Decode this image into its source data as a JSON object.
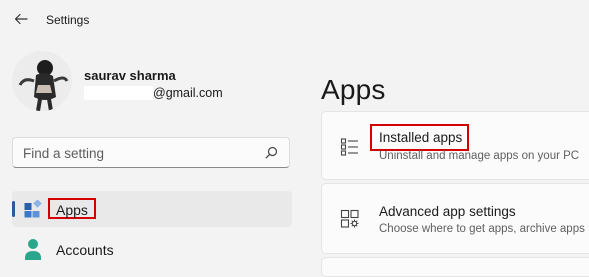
{
  "window": {
    "title": "Settings"
  },
  "profile": {
    "name": "saurav sharma",
    "email_domain": "@gmail.com"
  },
  "search": {
    "placeholder": "Find a setting"
  },
  "sidebar": {
    "items": [
      {
        "label": "Apps",
        "icon": "apps-icon",
        "selected": true
      },
      {
        "label": "Accounts",
        "icon": "person-icon",
        "selected": false
      }
    ]
  },
  "main": {
    "title": "Apps",
    "cards": [
      {
        "title": "Installed apps",
        "description": "Uninstall and manage apps on your PC",
        "icon": "list-icon"
      },
      {
        "title": "Advanced app settings",
        "description": "Choose where to get apps, archive apps",
        "icon": "app-settings-icon"
      }
    ]
  },
  "colors": {
    "accent": "#2b5a9c",
    "highlight_border": "#d40000",
    "background": "#f3f3f3"
  }
}
